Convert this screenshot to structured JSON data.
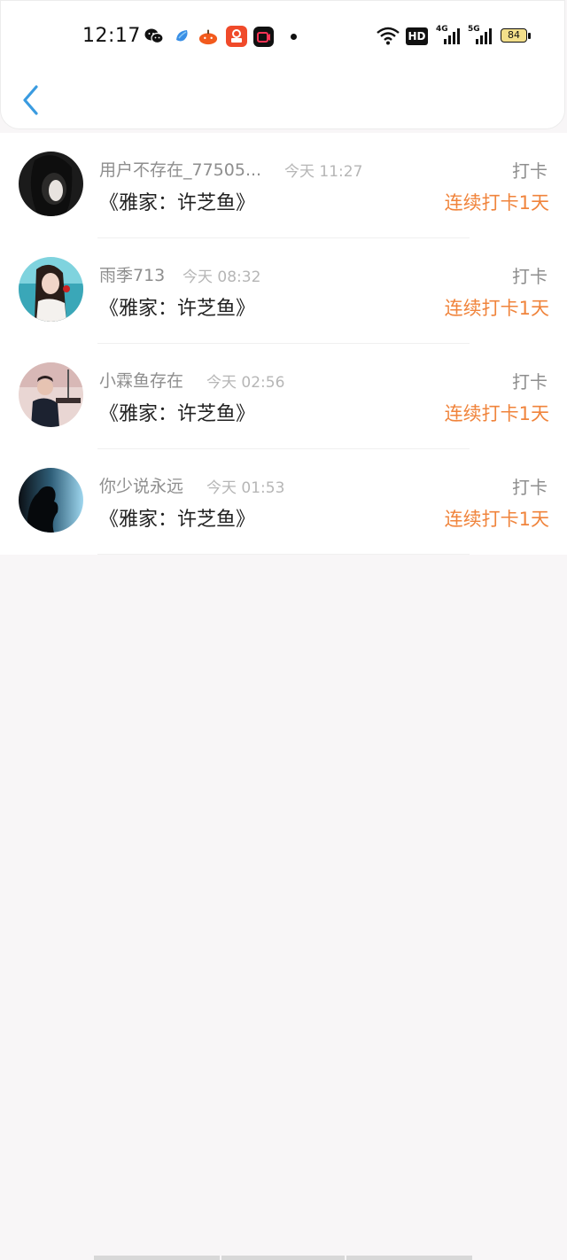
{
  "status_bar": {
    "time": "12:17",
    "hd_label": "HD",
    "net_4g": "4G",
    "net_5g": "5G",
    "battery": "84",
    "notification_icons": [
      "wechat-icon",
      "bird-app-icon",
      "pumpkin-app-icon",
      "shopping-app-icon",
      "video-app-icon"
    ]
  },
  "header": {
    "back_icon": "chevron-left-icon",
    "accent": "#3a9be0"
  },
  "items": [
    {
      "name": "用户不存在_77505...",
      "time": "今天 11:27",
      "book": "《雅家：许芝鱼》",
      "tag": "打卡",
      "streak": "连续打卡1天"
    },
    {
      "name": "雨季713",
      "time": "今天 08:32",
      "book": "《雅家：许芝鱼》",
      "tag": "打卡",
      "streak": "连续打卡1天"
    },
    {
      "name": "小霖鱼存在",
      "time": "今天 02:56",
      "book": "《雅家：许芝鱼》",
      "tag": "打卡",
      "streak": "连续打卡1天"
    },
    {
      "name": "你少说永远",
      "time": "今天 01:53",
      "book": "《雅家：许芝鱼》",
      "tag": "打卡",
      "streak": "连续打卡1天"
    }
  ],
  "colors": {
    "streak": "#f0843c",
    "muted": "#8e8e8e",
    "background": "#f8f6f7"
  }
}
